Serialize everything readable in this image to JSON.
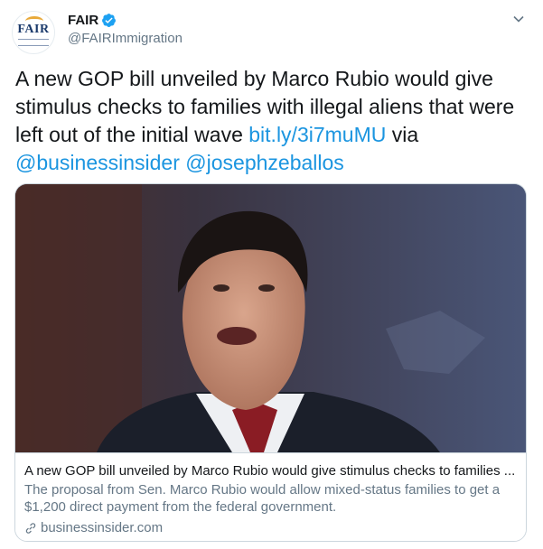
{
  "author": {
    "display_name": "FAIR",
    "handle": "@FAIRImmigration",
    "avatar_logo_text": "FAIR",
    "verified": true
  },
  "tweet": {
    "text_before_link": "A new GOP bill unveiled by Marco Rubio would give stimulus checks to families with illegal aliens that were left out of the initial wave ",
    "link": "bit.ly/3i7muMU",
    "text_between": " via ",
    "mention_1": "@businessinsider",
    "mention_2": "@josephzeballos"
  },
  "card": {
    "title": "A new GOP bill unveiled by Marco Rubio would give stimulus checks to families ...",
    "description": "The proposal from Sen. Marco Rubio would allow mixed-status families to get a $1,200 direct payment from the federal government.",
    "domain": "businessinsider.com"
  },
  "colors": {
    "link": "#1b95e0",
    "text": "#14171a",
    "secondary": "#657786",
    "border": "#ccd6dd",
    "verified": "#1da1f2"
  },
  "icons": [
    "verified-badge-icon",
    "chevron-down-icon",
    "link-icon"
  ]
}
